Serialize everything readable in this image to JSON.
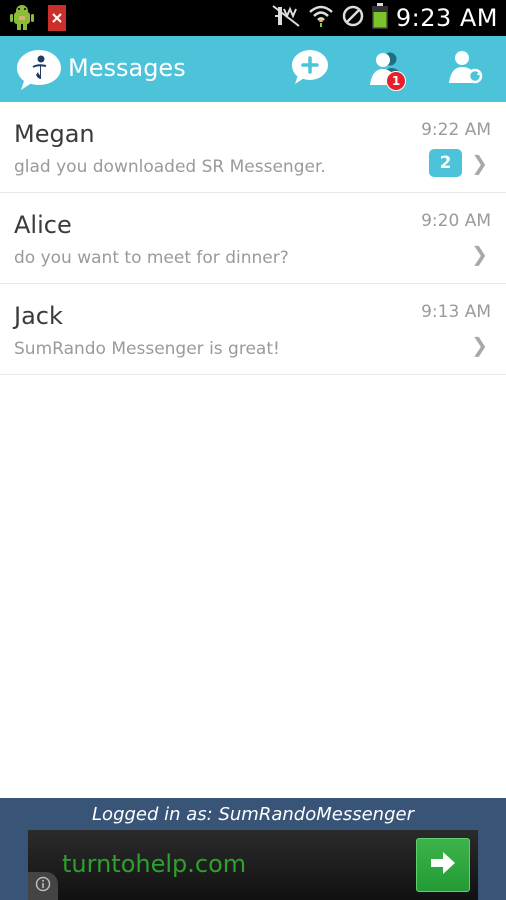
{
  "status_bar": {
    "time": "9:23 AM",
    "icons": [
      "android-debug-icon",
      "file-error-icon",
      "mute-icon",
      "wifi-icon",
      "no-sync-icon",
      "battery-icon"
    ]
  },
  "app_bar": {
    "title": "Messages",
    "notification_count": "1",
    "accent_color": "#4cc3d9",
    "actions": [
      "new-message-icon",
      "contacts-icon",
      "refresh-contacts-icon"
    ]
  },
  "conversations": [
    {
      "name": "Megan",
      "preview": "glad you downloaded SR Messenger.",
      "time": "9:22 AM",
      "unread": "2"
    },
    {
      "name": "Alice",
      "preview": "do you want to meet for dinner?",
      "time": "9:20 AM",
      "unread": ""
    },
    {
      "name": "Jack",
      "preview": "SumRando Messenger is great!",
      "time": "9:13 AM",
      "unread": ""
    }
  ],
  "chevron": "❯",
  "footer": {
    "logged_in_text": "Logged in as: SumRandoMessenger",
    "background_color": "#385477"
  },
  "ad": {
    "text": "turntohelp.com",
    "text_color": "#2ea02e"
  }
}
